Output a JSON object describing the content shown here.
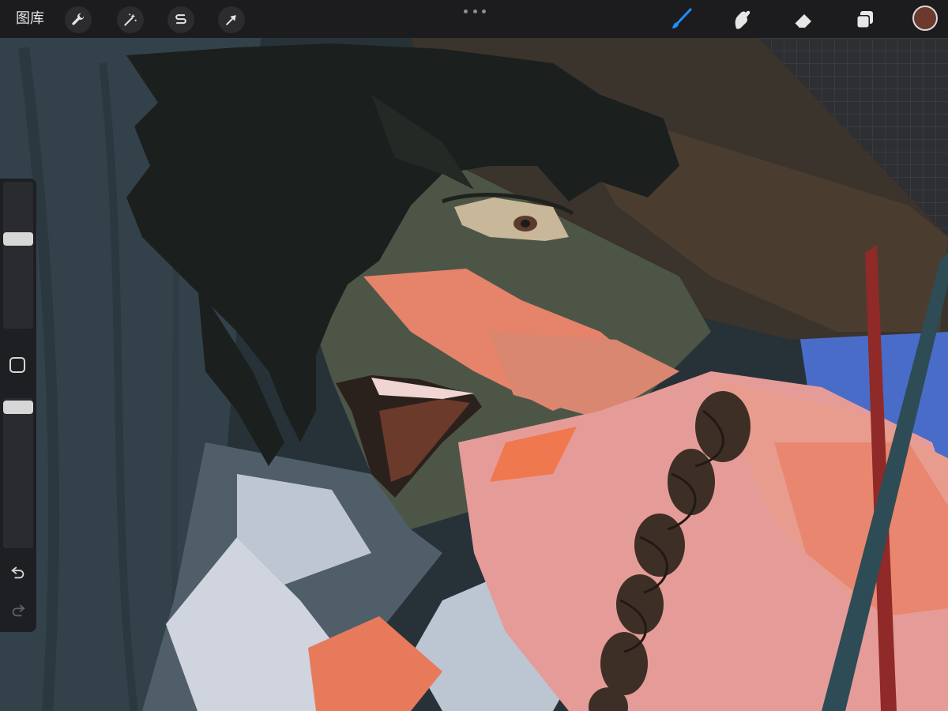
{
  "app": {
    "gallery_label": "图库"
  },
  "toolbar_left": [
    {
      "icon": "wrench-icon",
      "name": "actions"
    },
    {
      "icon": "magic-wand-icon",
      "name": "adjustments"
    },
    {
      "icon": "selection-icon",
      "name": "selection"
    },
    {
      "icon": "arrow-cursor-icon",
      "name": "transform"
    }
  ],
  "toolbar_right": [
    {
      "icon": "brush-icon",
      "name": "paint",
      "active": true,
      "color": "#1f8fff"
    },
    {
      "icon": "smudge-icon",
      "name": "smudge"
    },
    {
      "icon": "eraser-icon",
      "name": "erase"
    },
    {
      "icon": "layers-icon",
      "name": "layers"
    }
  ],
  "colors": {
    "active_tool": "#1f8fff",
    "current_color": "#6b3a2c",
    "toolbar_bg": "#1c1c1e",
    "sidebar_bg": "#1e1f22"
  },
  "sidebar": {
    "brush_size_level": 0.62,
    "opacity_level": 0.98,
    "icons": [
      "undo-icon",
      "redo-icon"
    ]
  }
}
